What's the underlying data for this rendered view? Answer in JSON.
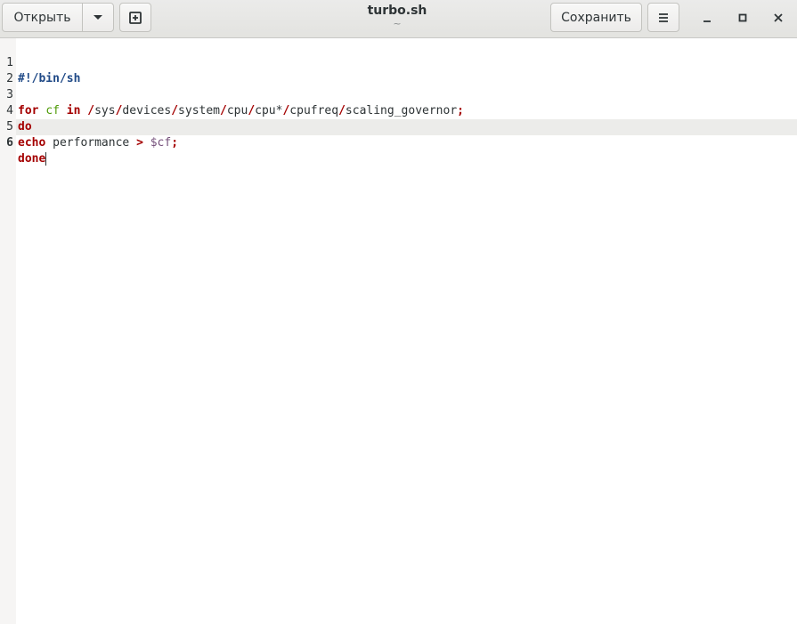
{
  "header": {
    "open_label": "Открыть",
    "save_label": "Сохранить",
    "title": "turbo.sh",
    "subtitle": "~"
  },
  "editor": {
    "line_numbers": [
      "1",
      "2",
      "3",
      "4",
      "5",
      "6"
    ],
    "current_line": 6,
    "code": {
      "l1_shebang": "#!/bin/sh",
      "l3_for": "for",
      "l3_var": "cf",
      "l3_in": "in",
      "l3_s1": "/",
      "l3_p1": "sys",
      "l3_s2": "/",
      "l3_p2": "devices",
      "l3_s3": "/",
      "l3_p3": "system",
      "l3_s4": "/",
      "l3_p4": "cpu",
      "l3_s5": "/",
      "l3_p5": "cpu",
      "l3_star": "*",
      "l3_s6": "/",
      "l3_p6": "cpufreq",
      "l3_s7": "/",
      "l3_p7": "scaling_governor",
      "l3_semi": ";",
      "l4_do": "do",
      "l5_echo": "echo",
      "l5_arg": "performance",
      "l5_gt": ">",
      "l5_dollar": "$cf",
      "l5_semi": ";",
      "l6_done": "done"
    }
  },
  "colors": {
    "keyword": "#a40000",
    "shebang": "#204a87",
    "variable": "#4e9a06",
    "dollar_var": "#75507b",
    "current_line_bg": "#ececea"
  }
}
